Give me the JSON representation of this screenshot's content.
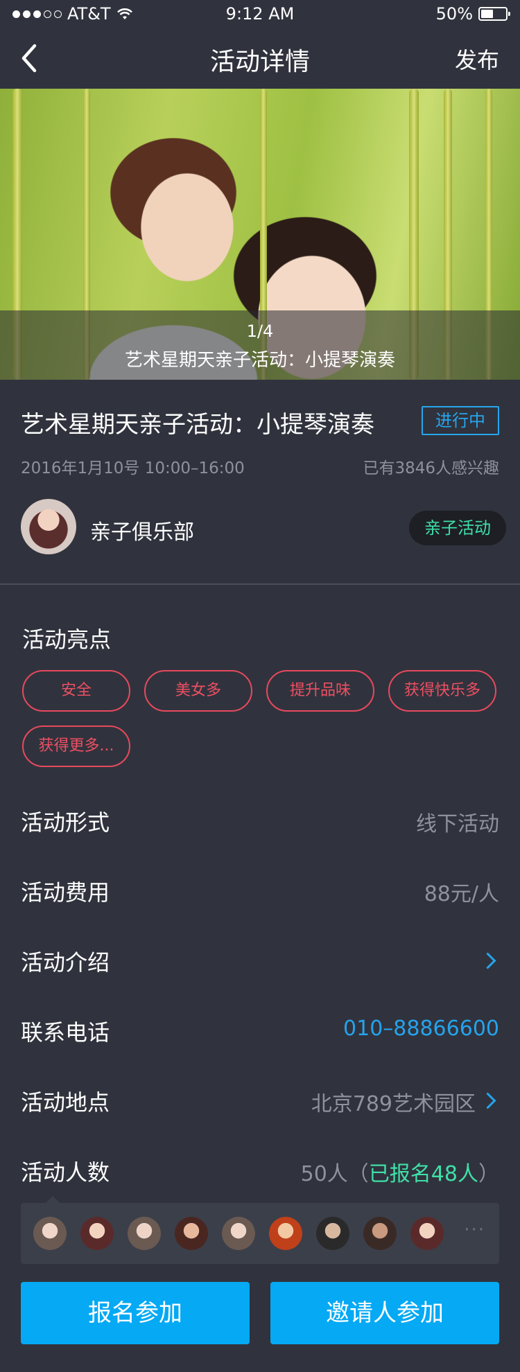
{
  "status_bar": {
    "carrier": "AT&T",
    "time": "9:12 AM",
    "battery": "50%",
    "battery_level": 0.5
  },
  "nav": {
    "title": "活动详情",
    "publish": "发布"
  },
  "banner": {
    "counter": "1/4",
    "caption": "艺术星期天亲子活动：小提琴演奏"
  },
  "event": {
    "title": "艺术星期天亲子活动：小提琴演奏",
    "status": "进行中",
    "date": "2016年1月10号 10:00–16:00",
    "interest": "已有3846人感兴趣",
    "club_name": "亲子俱乐部",
    "club_tag": "亲子活动"
  },
  "highlights": {
    "title": "活动亮点",
    "tags": [
      "安全",
      "美女多",
      "提升品味",
      "获得快乐多",
      "获得更多..."
    ]
  },
  "details": {
    "form_label": "活动形式",
    "form_value": "线下活动",
    "fee_label": "活动费用",
    "fee_value": "88元/人",
    "intro_label": "活动介绍",
    "phone_label": "联系电话",
    "phone_value": "010–88866600",
    "place_label": "活动地点",
    "place_value": "北京789艺术园区",
    "count_label": "活动人数",
    "count_value": "50人（",
    "count_registered": "已报名48人",
    "count_close": "）"
  },
  "participants": {
    "more": "···"
  },
  "actions": {
    "join": "报名参加",
    "invite": "邀请人参加"
  },
  "colors": {
    "background": "#30333d",
    "accent_blue": "#26a3ec",
    "accent_green": "#3fe0a8",
    "tag_red": "#e8495e",
    "button": "#05a9f4"
  }
}
